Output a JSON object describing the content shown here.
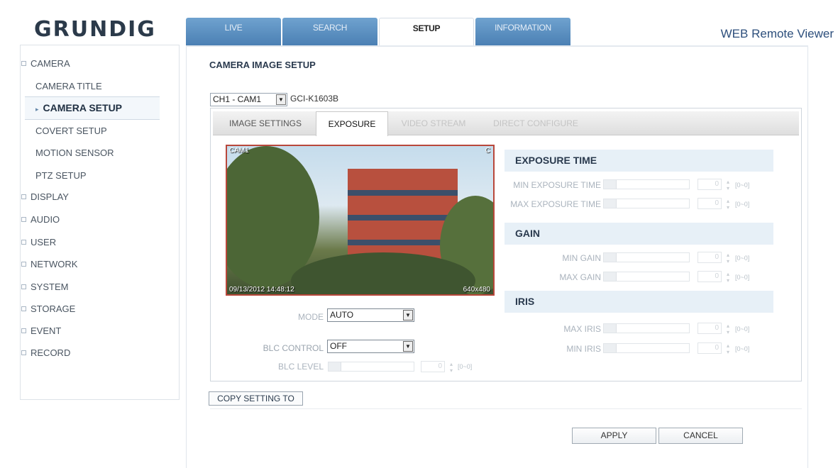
{
  "brand": {
    "logo": "GRUNDIG",
    "product": "WEB Remote Viewer"
  },
  "topnav": [
    "LIVE",
    "SEARCH",
    "SETUP",
    "INFORMATION"
  ],
  "sidebar": {
    "camera": "CAMERA",
    "camera_subitems": [
      "CAMERA TITLE",
      "CAMERA SETUP",
      "COVERT SETUP",
      "MOTION SENSOR",
      "PTZ SETUP"
    ],
    "others": [
      "DISPLAY",
      "AUDIO",
      "USER",
      "NETWORK",
      "SYSTEM",
      "STORAGE",
      "EVENT",
      "RECORD"
    ]
  },
  "page": {
    "title": "CAMERA IMAGE SETUP",
    "camera_select": "CH1 - CAM1",
    "camera_model": "GCI-K1603B"
  },
  "subtabs": [
    "IMAGE SETTINGS",
    "EXPOSURE",
    "VIDEO STREAM",
    "DIRECT CONFIGURE"
  ],
  "preview": {
    "cam_label": "CAM1",
    "corner_label": "C",
    "timestamp": "09/13/2012 14:48:12",
    "resolution": "640x480"
  },
  "exposure_left": {
    "mode_label": "MODE",
    "mode_value": "AUTO",
    "blc_label": "BLC CONTROL",
    "blc_value": "OFF",
    "blc_level_label": "BLC LEVEL",
    "blc_level_value": "0",
    "blc_level_range": "[0~0]"
  },
  "exposure_right": {
    "exposure_time": {
      "header": "EXPOSURE TIME",
      "min_label": "MIN EXPOSURE TIME",
      "min_value": "0",
      "min_range": "[0~0]",
      "max_label": "MAX EXPOSURE TIME",
      "max_value": "0",
      "max_range": "[0~0]"
    },
    "gain": {
      "header": "GAIN",
      "min_label": "MIN GAIN",
      "min_value": "0",
      "min_range": "[0~0]",
      "max_label": "MAX GAIN",
      "max_value": "0",
      "max_range": "[0~0]"
    },
    "iris": {
      "header": "IRIS",
      "max_label": "MAX IRIS",
      "max_value": "0",
      "max_range": "[0~0]",
      "min_label": "MIN IRIS",
      "min_value": "0",
      "min_range": "[0~0]"
    }
  },
  "actions": {
    "copy_label": "COPY SETTING TO",
    "apply_label": "APPLY",
    "cancel_label": "CANCEL"
  }
}
